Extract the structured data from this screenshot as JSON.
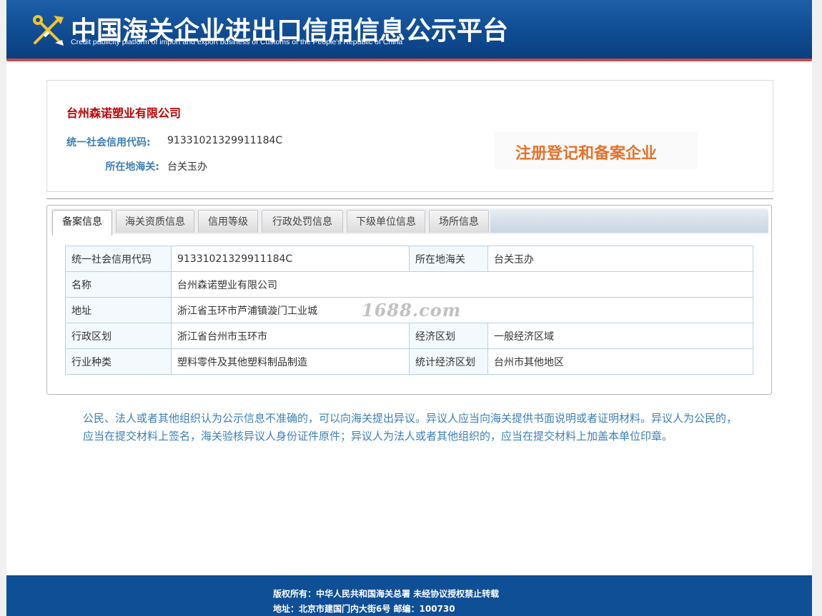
{
  "header": {
    "title": "中国海关企业进出口信用信息公示平台",
    "subtitle": "Credit publicity platform of import and export business of Customs of the People's Republic of China",
    "logo_icon": "customs-emblem-icon"
  },
  "company": {
    "name": "台州森诺塑业有限公司",
    "credit_code_label": "统一社会信用代码:",
    "credit_code": "91331021329911184C",
    "customs_label": "所在地海关:",
    "customs": "台关玉办",
    "badge": "注册登记和备案企业"
  },
  "tabs": [
    {
      "label": "备案信息",
      "active": true
    },
    {
      "label": "海关资质信息",
      "active": false
    },
    {
      "label": "信用等级",
      "active": false
    },
    {
      "label": "行政处罚信息",
      "active": false
    },
    {
      "label": "下级单位信息",
      "active": false
    },
    {
      "label": "场所信息",
      "active": false
    }
  ],
  "record": {
    "credit_code_label": "统一社会信用代码",
    "credit_code": "91331021329911184C",
    "customs_label": "所在地海关",
    "customs": "台关玉办",
    "name_label": "名称",
    "name": "台州森诺塑业有限公司",
    "address_label": "地址",
    "address": "浙江省玉环市芦浦镇漩门工业城",
    "admin_label": "行政区划",
    "admin": "浙江省台州市玉环市",
    "econ_label": "经济区划",
    "econ": "一般经济区域",
    "industry_label": "行业种类",
    "industry": "塑料零件及其他塑料制品制造",
    "stat_label": "统计经济区划",
    "stat": "台州市其他地区"
  },
  "watermark": "1688.com",
  "notice": "公民、法人或者其他组织认为公示信息不准确的，可以向海关提出异议。异议人应当向海关提供书面说明或者证明材料。异议人为公民的，应当在提交材料上签名，海关验核异议人身份证件原件；异议人为法人或者其他组织的，应当在提交材料上加盖本单位印章。",
  "footer": {
    "copyright": "版权所有：中华人民共和国海关总署  未经协议授权禁止转载",
    "address": "地址：北京市建国门内大街6号 邮编：100730"
  }
}
